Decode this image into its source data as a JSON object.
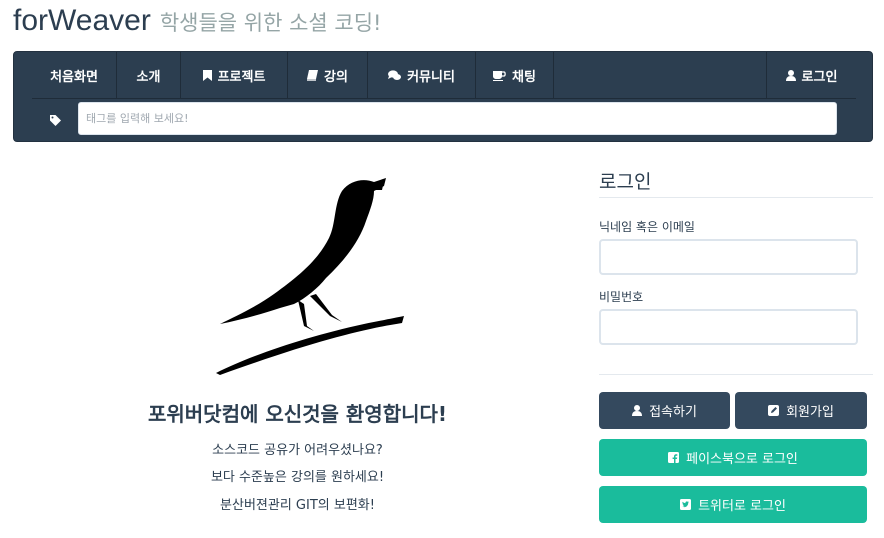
{
  "brand": {
    "name": "forWeaver",
    "tagline": "학생들을 위한 소셜 코딩!"
  },
  "nav": {
    "items": [
      {
        "label": "처음화면",
        "icon": ""
      },
      {
        "label": "소개",
        "icon": ""
      },
      {
        "label": "프로젝트",
        "icon": "bookmark-icon"
      },
      {
        "label": "강의",
        "icon": "book-icon"
      },
      {
        "label": "커뮤니티",
        "icon": "comments-icon"
      },
      {
        "label": "채팅",
        "icon": "coffee-icon"
      }
    ],
    "login": {
      "label": "로그인",
      "icon": "user-icon"
    },
    "tag_search": {
      "placeholder": "태그를 입력해 보세요!",
      "icon": "tag-icon",
      "value": ""
    }
  },
  "hero": {
    "image": "bird-icon",
    "title": "포위버닷컴에 오신것을 환영합니다!",
    "lines": [
      "소스코드 공유가 어려우셨나요?",
      "보다 수준높은 강의를 원하세요!",
      "분산버젼관리 GIT의 보편화!"
    ]
  },
  "login_panel": {
    "title": "로그인",
    "id_label": "닉네임 혹은 이메일",
    "id_value": "",
    "password_label": "비밀번호",
    "password_value": "",
    "connect_button": "접속하기",
    "signup_button": "회원가입",
    "facebook_button": "페이스북으로 로그인",
    "twitter_button": "트위터로 로그인"
  },
  "colors": {
    "navbar": "#2c3e50",
    "dark_button": "#34495e",
    "social_button": "#1abc9c",
    "text": "#2c3e50",
    "muted": "#95a5a6"
  }
}
